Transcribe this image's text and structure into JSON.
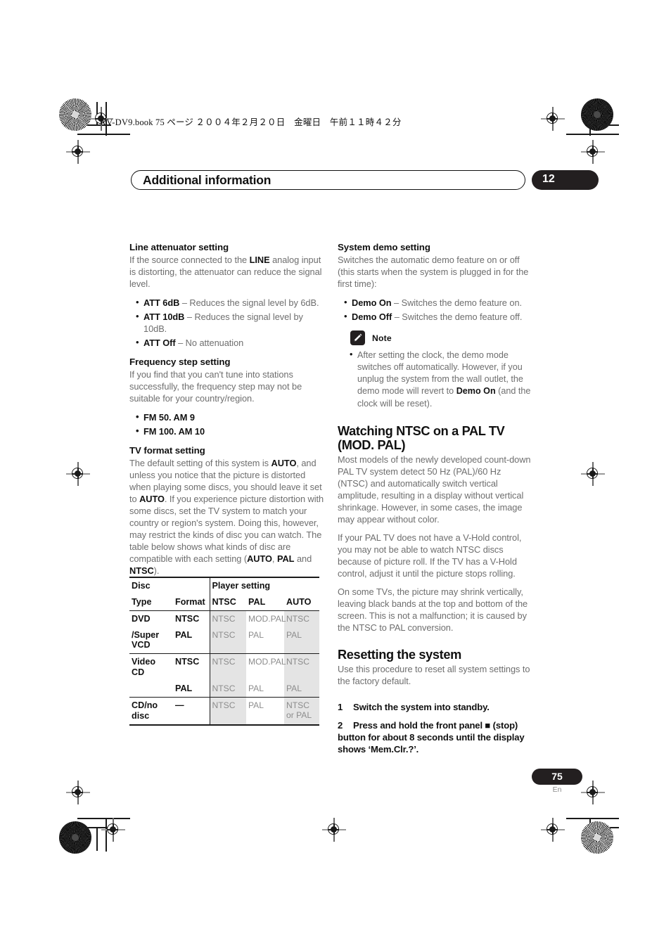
{
  "slug": "XV-DV9.book  75 ページ  ２００４年２月２０日　金曜日　午前１１時４２分",
  "header": {
    "chapter_title": "Additional information",
    "chapter_number": "12"
  },
  "footer": {
    "page_number": "75",
    "language_code": "En"
  },
  "left_column": {
    "line_attenuator": {
      "heading": "Line attenuator setting",
      "body_1": "If the source connected to the ",
      "body_1_bold": "LINE",
      "body_1_rest": " analog input is distorting, the attenuator can reduce the signal level.",
      "bullets": [
        {
          "term": "ATT 6dB",
          "desc": " – Reduces the signal level by 6dB."
        },
        {
          "term": "ATT 10dB",
          "desc": " – Reduces the signal level by 10dB."
        },
        {
          "term": "ATT Off",
          "desc": " – No attenuation"
        }
      ]
    },
    "frequency_step": {
      "heading": "Frequency step setting",
      "body": "If you find that you can't tune into stations successfully, the frequency step may not be suitable for your country/region.",
      "bullets": [
        "FM 50. AM 9",
        "FM 100. AM 10"
      ]
    },
    "tv_format": {
      "heading": "TV format setting",
      "body_parts": [
        {
          "t": "The default setting of this system is ",
          "b": false
        },
        {
          "t": "AUTO",
          "b": true
        },
        {
          "t": ", and unless you notice that the picture is distorted when playing some discs, you should leave it set to ",
          "b": false
        },
        {
          "t": "AUTO",
          "b": true
        },
        {
          "t": ". If you experience picture distortion with some discs, set the TV system to match your country or region's system. Doing this, however, may restrict the kinds of disc you can watch. The table below shows what kinds of disc are compatible with each setting (",
          "b": false
        },
        {
          "t": "AUTO",
          "b": true
        },
        {
          "t": ", ",
          "b": false
        },
        {
          "t": "PAL",
          "b": true
        },
        {
          "t": " and ",
          "b": false
        },
        {
          "t": "NTSC",
          "b": true
        },
        {
          "t": ").",
          "b": false
        }
      ]
    }
  },
  "disc_table": {
    "group_headers": {
      "disc": "Disc",
      "player_setting": "Player setting"
    },
    "sub_headers": {
      "type": "Type",
      "format": "Format",
      "ntsc": "NTSC",
      "pal": "PAL",
      "auto": "AUTO"
    },
    "rows": [
      {
        "type": "DVD",
        "format": "NTSC",
        "ntsc": "NTSC",
        "pal": "MOD.PAL",
        "auto": "NTSC",
        "group_start": true
      },
      {
        "type": "/Super VCD",
        "format": "PAL",
        "ntsc": "NTSC",
        "pal": "PAL",
        "auto": "PAL",
        "group_start": false
      },
      {
        "type": "Video CD",
        "format": "NTSC",
        "ntsc": "NTSC",
        "pal": "MOD.PAL",
        "auto": "NTSC",
        "group_start": true
      },
      {
        "type": "",
        "format": "PAL",
        "ntsc": "NTSC",
        "pal": "PAL",
        "auto": "PAL",
        "group_start": false
      },
      {
        "type": "CD/no disc",
        "format": "—",
        "ntsc": "NTSC",
        "pal": "PAL",
        "auto": "NTSC or PAL",
        "group_start": true
      }
    ]
  },
  "right_column": {
    "system_demo": {
      "heading": "System demo setting",
      "body": "Switches the automatic demo feature on or off (this starts when the system is plugged in for the first time):",
      "bullets": [
        {
          "term": "Demo On",
          "desc": " – Switches the demo feature on."
        },
        {
          "term": "Demo Off",
          "desc": " – Switches the demo feature off."
        }
      ]
    },
    "note": {
      "label": "Note",
      "icon": "pencil-note-icon",
      "text_1": "After setting the clock, the demo mode switches off automatically. However, if you unplug the system from the wall outlet, the demo mode will revert to ",
      "text_bold": "Demo On",
      "text_2": " (and the clock will be reset)."
    },
    "watching_ntsc": {
      "heading_line1": "Watching NTSC on a PAL TV",
      "heading_line2": "(MOD. PAL)",
      "para_1": "Most models of the newly developed count-down PAL TV system detect 50 Hz (PAL)/60 Hz (NTSC) and automatically switch vertical amplitude, resulting in a display without vertical shrinkage. However, in some cases, the image may appear without color.",
      "para_2": "If your PAL TV does not have a V-Hold control, you may not be able to watch NTSC discs because of picture roll. If the TV has a V-Hold control, adjust it until the picture stops rolling.",
      "para_3": "On some TVs, the picture may shrink vertically, leaving black bands at the top and bottom of the screen. This is not a malfunction; it is caused by the NTSC to PAL conversion."
    },
    "resetting": {
      "heading": "Resetting the system",
      "body": "Use this procedure to reset all system settings to the factory default.",
      "steps": [
        {
          "num": "1",
          "text": "Switch the system into standby."
        },
        {
          "num": "2",
          "text_a": "Press and hold the front panel ",
          "glyph": "■",
          "text_b": " (stop) button for about 8 seconds until the display shows ‘Mem.Clr.?’."
        }
      ]
    }
  }
}
